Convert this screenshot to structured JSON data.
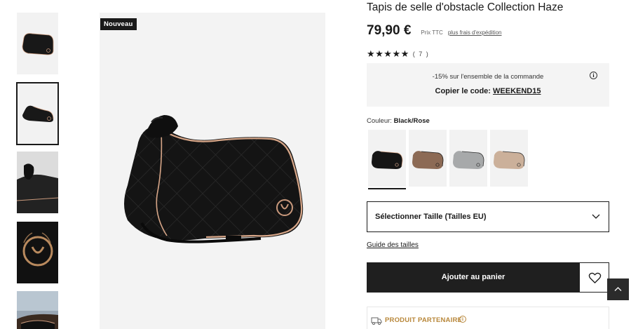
{
  "gallery": {
    "badge": "Nouveau",
    "thumbnails": [
      {
        "name": "thumb-front",
        "selected": false
      },
      {
        "name": "thumb-side",
        "selected": true
      },
      {
        "name": "thumb-worn",
        "selected": false
      },
      {
        "name": "thumb-logo-detail",
        "selected": false
      },
      {
        "name": "thumb-outdoor",
        "selected": false
      }
    ]
  },
  "product": {
    "title": "Tapis de selle d'obstacle Collection Haze",
    "price": "79,90 €",
    "price_note": "Prix TTC",
    "shipping_link": "plus frais d'expédition",
    "stars": "★★★★★",
    "rating_value": 5,
    "review_count": "( 7 )"
  },
  "promo": {
    "line": "-15% sur l'ensemble de la commande",
    "code_prefix": "Copier le code: ",
    "code": "WEEKEND15",
    "info_icon": "i"
  },
  "color": {
    "label": "Couleur: ",
    "selected": "Black/Rose",
    "swatches": [
      {
        "name": "Black/Rose",
        "pad": "#161616",
        "trim": "#d9a98c"
      },
      {
        "name": "brown",
        "pad": "#8c6a55",
        "trim": "#1a1a1a"
      },
      {
        "name": "grey",
        "pad": "#a7a9aa",
        "trim": "#2a2a2a"
      },
      {
        "name": "beige",
        "pad": "#cbb09a",
        "trim": "#2a2a2a"
      }
    ]
  },
  "size": {
    "select_label": "Sélectionner Taille (Tailles EU)",
    "guide_link": "Guide des tailles"
  },
  "actions": {
    "add_to_cart": "Ajouter au panier"
  },
  "partner": {
    "label": "PRODUIT PARTENAIRE",
    "info_icon": "i"
  },
  "colors": {
    "primary": "#1f1f1f",
    "promo_bg": "#f4f4f4",
    "partner_gold": "#b8873a"
  }
}
